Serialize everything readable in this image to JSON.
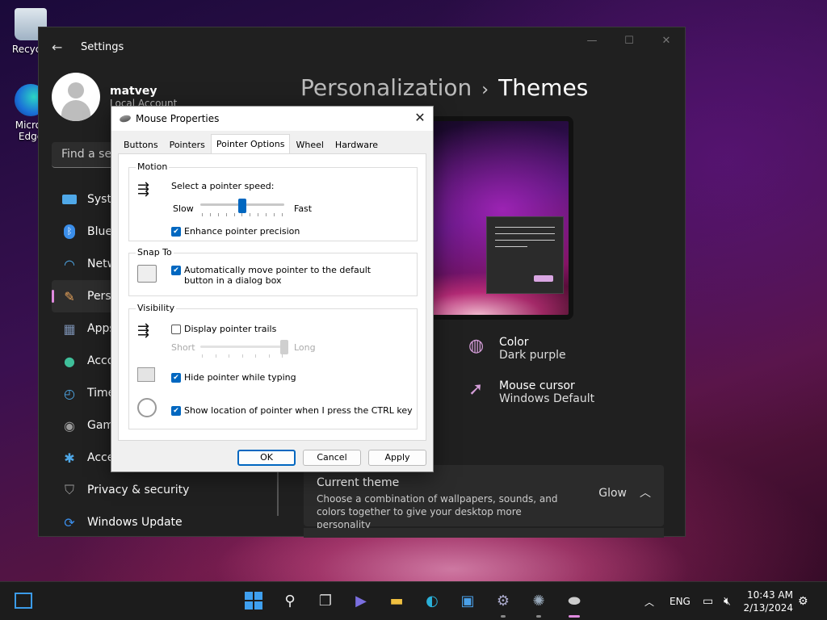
{
  "desktop": {
    "icons": [
      {
        "label": "Recycle"
      },
      {
        "label": "Micros Edge"
      }
    ]
  },
  "settings": {
    "title": "Settings",
    "user": {
      "name": "matvey",
      "account": "Local Account"
    },
    "search_placeholder": "Find a setting",
    "nav": [
      {
        "label": "System",
        "icon": "monitor-icon",
        "color": "#4fa8e8"
      },
      {
        "label": "Bluetooth & devices",
        "icon": "bluetooth-icon",
        "color": "#3b8eea"
      },
      {
        "label": "Network & internet",
        "icon": "wifi-icon",
        "color": "#4fa8e8"
      },
      {
        "label": "Personalization",
        "icon": "brush-icon",
        "color": "#e8a35a",
        "active": true
      },
      {
        "label": "Apps",
        "icon": "apps-icon",
        "color": "#7a8fb0"
      },
      {
        "label": "Accounts",
        "icon": "person-icon",
        "color": "#3fbf9a"
      },
      {
        "label": "Time & language",
        "icon": "globe-clock-icon",
        "color": "#4fa8e8"
      },
      {
        "label": "Gaming",
        "icon": "gamepad-icon",
        "color": "#9a9a9a"
      },
      {
        "label": "Accessibility",
        "icon": "accessibility-icon",
        "color": "#4fa8e8"
      },
      {
        "label": "Privacy & security",
        "icon": "shield-icon",
        "color": "#9a9a9a"
      },
      {
        "label": "Windows Update",
        "icon": "refresh-icon",
        "color": "#3b8eea"
      }
    ],
    "breadcrumb": {
      "parent": "Personalization",
      "separator": "›",
      "current": "Themes"
    },
    "props": {
      "color": {
        "label": "Color",
        "value": "Dark purple"
      },
      "cursor": {
        "label": "Mouse cursor",
        "value": "Windows Default"
      }
    },
    "current_theme": {
      "title": "Current theme",
      "description": "Choose a combination of wallpapers, sounds, and colors together to give your desktop more personality",
      "value": "Glow"
    },
    "accent": "#e08adf"
  },
  "dialog": {
    "title": "Mouse Properties",
    "close": "✕",
    "tabs": [
      "Buttons",
      "Pointers",
      "Pointer Options",
      "Wheel",
      "Hardware"
    ],
    "active_tab": "Pointer Options",
    "motion": {
      "label": "Motion",
      "prompt": "Select a pointer speed:",
      "slow": "Slow",
      "fast": "Fast",
      "speed_fraction": 0.5,
      "precision": {
        "label": "Enhance pointer precision",
        "checked": true
      }
    },
    "snap_to": {
      "label": "Snap To",
      "option": {
        "label": "Automatically move pointer to the default button in a dialog box",
        "checked": true
      }
    },
    "visibility": {
      "label": "Visibility",
      "trails": {
        "label": "Display pointer trails",
        "checked": false
      },
      "short": "Short",
      "long": "Long",
      "trail_fraction": 1.0,
      "hide_typing": {
        "label": "Hide pointer while typing",
        "checked": true
      },
      "show_ctrl": {
        "label": "Show location of pointer when I press the CTRL key",
        "checked": true
      }
    },
    "buttons": {
      "ok": "OK",
      "cancel": "Cancel",
      "apply": "Apply"
    },
    "accent": "#0067c0"
  },
  "taskbar": {
    "language": "ENG",
    "time": "10:43 AM",
    "date": "2/13/2024"
  }
}
